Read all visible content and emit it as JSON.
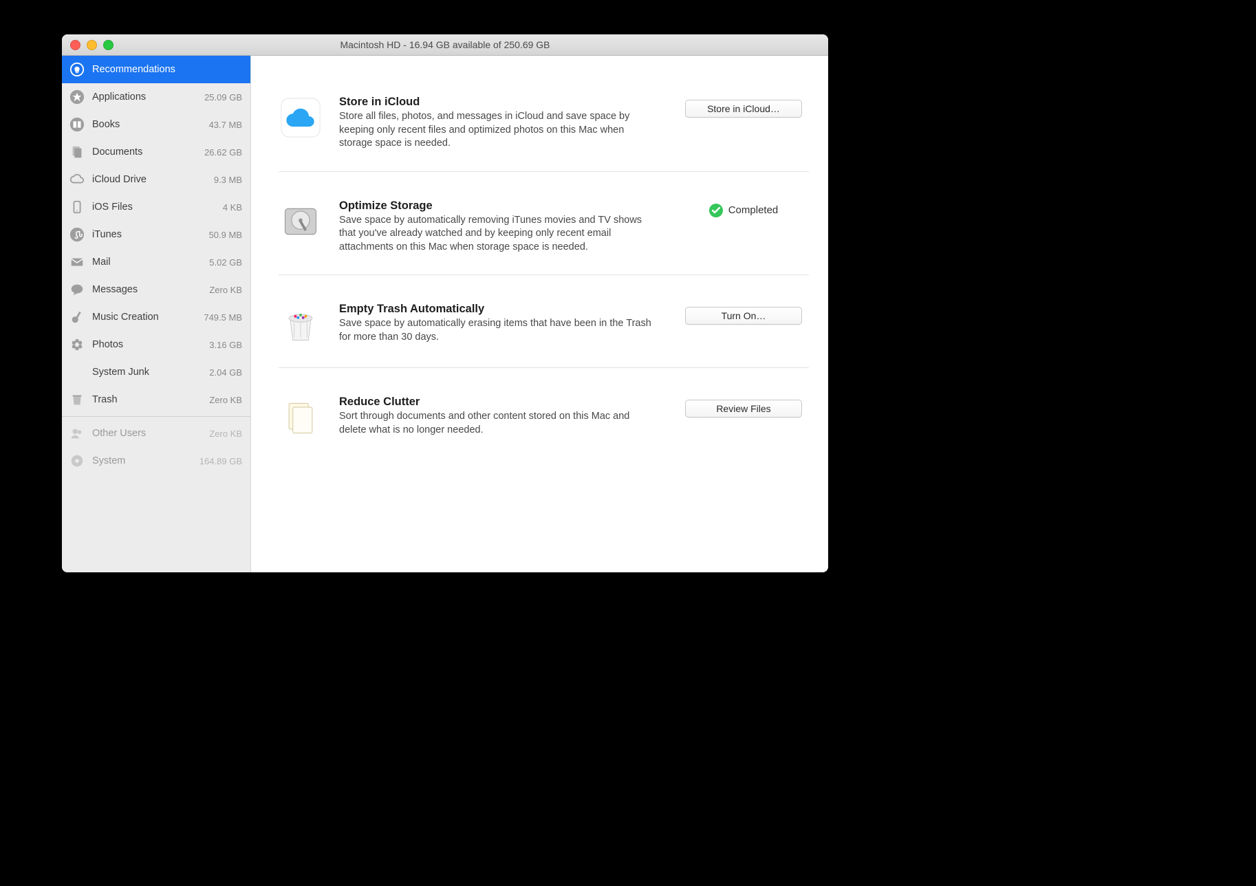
{
  "title": "Macintosh HD - 16.94 GB available of 250.69 GB",
  "sidebar": {
    "selected_label": "Recommendations",
    "items": [
      {
        "label": "Applications",
        "size": "25.09 GB"
      },
      {
        "label": "Books",
        "size": "43.7 MB"
      },
      {
        "label": "Documents",
        "size": "26.62 GB"
      },
      {
        "label": "iCloud Drive",
        "size": "9.3 MB"
      },
      {
        "label": "iOS Files",
        "size": "4 KB"
      },
      {
        "label": "iTunes",
        "size": "50.9 MB"
      },
      {
        "label": "Mail",
        "size": "5.02 GB"
      },
      {
        "label": "Messages",
        "size": "Zero KB"
      },
      {
        "label": "Music Creation",
        "size": "749.5 MB"
      },
      {
        "label": "Photos",
        "size": "3.16 GB"
      },
      {
        "label": "System Junk",
        "size": "2.04 GB"
      },
      {
        "label": "Trash",
        "size": "Zero KB"
      }
    ],
    "footer": [
      {
        "label": "Other Users",
        "size": "Zero KB"
      },
      {
        "label": "System",
        "size": "164.89 GB"
      }
    ]
  },
  "recs": {
    "icloud": {
      "title": "Store in iCloud",
      "desc": "Store all files, photos, and messages in iCloud and save space by keeping only recent files and optimized photos on this Mac when storage space is needed.",
      "button": "Store in iCloud…"
    },
    "optimize": {
      "title": "Optimize Storage",
      "desc": "Save space by automatically removing iTunes movies and TV shows that you've already watched and by keeping only recent email attachments on this Mac when storage space is needed.",
      "status": "Completed"
    },
    "trash": {
      "title": "Empty Trash Automatically",
      "desc": "Save space by automatically erasing items that have been in the Trash for more than 30 days.",
      "button": "Turn On…"
    },
    "clutter": {
      "title": "Reduce Clutter",
      "desc": "Sort through documents and other content stored on this Mac and delete what is no longer needed.",
      "button": "Review Files"
    }
  }
}
